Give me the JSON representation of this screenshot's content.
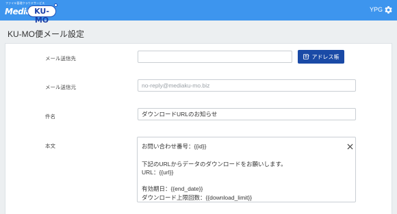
{
  "header": {
    "logo_tagline": "ファイル管理クラウドサービス",
    "logo_prefix": "Media",
    "logo_brand": "KU-MO",
    "user": "YPG",
    "settings_icon": "gear-icon"
  },
  "page": {
    "title": "KU-MO便メール設定"
  },
  "form": {
    "to_label": "メール送信先",
    "to_value": "",
    "address_book_button": "アドレス帳",
    "from_label": "メール送信元",
    "from_value": "no-reply@mediaku-mo.biz",
    "subject_label": "件名",
    "subject_value": "ダウンロードURLのお知らせ",
    "body_label": "本文",
    "body_lines": [
      "お問い合わせ番号：{{id}}",
      "下記のURLからデータのダウンロードをお願いします。",
      "URL：{{url}}",
      "有効期日：{{end_date}}",
      "ダウンロード上限回数：{{download_limit}}"
    ]
  },
  "colors": {
    "topbar": "#3d95ee",
    "primary_button": "#1a4aa6"
  }
}
